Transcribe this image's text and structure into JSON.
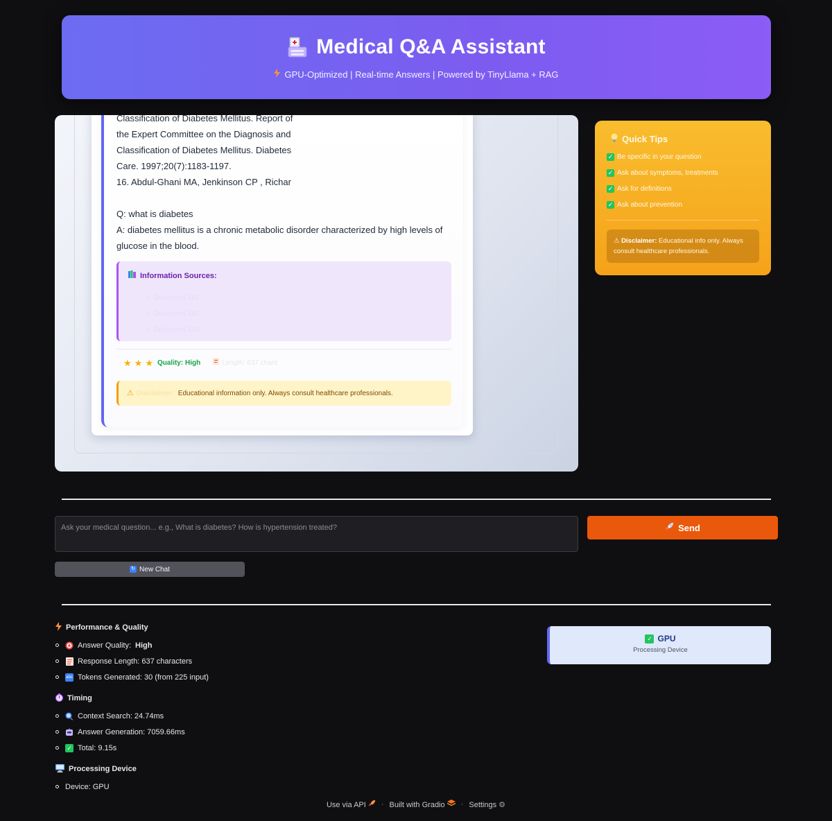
{
  "header": {
    "title": "Medical Q&A Assistant",
    "subtitle": "GPU-Optimized | Real-time Answers | Powered by TinyLlama + RAG"
  },
  "chat": {
    "reference_lines": [
      "Classification of Diabetes Mellitus. Report of",
      "the Expert Committee on the Diagnosis and",
      "Classification of Diabetes Mellitus. Diabetes",
      "Care. 1997;20(7):1183-1197.",
      "16. Abdul-Ghani MA, Jenkinson CP , Richar"
    ],
    "question": "Q: what is diabetes",
    "answer": "A: diabetes mellitus is a chronic metabolic disorder characterized by high levels of glucose in the blood.",
    "sources_title": "Information Sources:",
    "sources": [
      "✓ Document 164",
      "✓ Document 162",
      "✓ Document 104"
    ],
    "quality_label": "Quality: High",
    "length_label": "Length: 637 chars",
    "disclaimer_label": "Disclaimer:",
    "disclaimer_text": "Educational information only. Always consult healthcare professionals."
  },
  "tips": {
    "title": "Quick Tips",
    "items": [
      "Be specific in your question",
      "Ask about symptoms, treatments",
      "Ask for definitions",
      "Ask about prevention"
    ],
    "disclaimer_label": "Disclaimer:",
    "disclaimer_text": "Educational info only. Always consult healthcare professionals."
  },
  "input": {
    "placeholder": "Ask your medical question... e.g., What is diabetes? How is hypertension treated?",
    "value": ""
  },
  "buttons": {
    "send": "Send",
    "new_chat": "New Chat"
  },
  "stats": {
    "performance_title": "Performance & Quality",
    "answer_quality_label": "Answer Quality:",
    "answer_quality_value": "High",
    "response_length": "Response Length: 637 characters",
    "tokens_generated": "Tokens Generated: 30 (from 225 input)",
    "timing_title": "Timing",
    "context_search": "Context Search: 24.74ms",
    "answer_generation": "Answer Generation: 7059.66ms",
    "total": "Total: 9.15s",
    "device_title": "Processing Device",
    "device": "Device: GPU"
  },
  "gpu_card": {
    "title": "GPU",
    "subtitle": "Processing Device"
  },
  "footer": {
    "api": "Use via API",
    "built": "Built with Gradio",
    "settings": "Settings"
  },
  "colors": {
    "header_gradient_start": "#6c6cf2",
    "header_gradient_end": "#8b5cf6",
    "send_button": "#ea580c",
    "tips_background": "#f8bd2e",
    "accent_border": "#6366f1"
  }
}
